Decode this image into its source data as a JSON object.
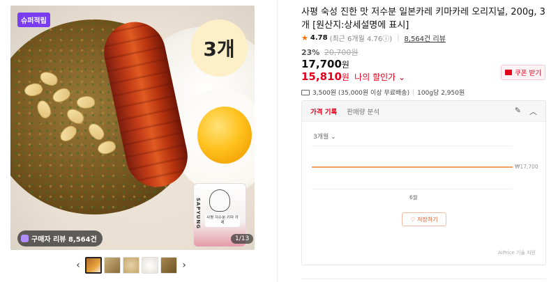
{
  "gallery": {
    "super_badge": "슈퍼적립",
    "count_text": "3개",
    "pouch_brand": "SAPYUNG",
    "pouch_label": "사평 저수분 키마 카레",
    "review_pill": "구매자 리뷰 8,564건",
    "page_indicator": "1/13",
    "prev_arrow": "‹",
    "next_arrow": "›",
    "thumbnail_colors": [
      "#b06a2a",
      "#c9b27c",
      "#e5d1a9",
      "#efe7dc",
      "#a8874d"
    ]
  },
  "product": {
    "title": "사평 숙성 진한 맛 저수분 일본카레 키마카레 오리지널, 200g, 3개 [원산지:상세설명에 표시]",
    "rating": {
      "star": "★",
      "score": "4.78",
      "recent": "(최근 6개월 4.76ⓘ)",
      "separator": "|",
      "reviews": "8,564건 리뷰"
    },
    "discount_percent": "23%",
    "original_price": "20,700원",
    "price_value": "17,700",
    "price_unit": "원",
    "my_price_value": "15,810",
    "my_price_unit": "원",
    "my_price_label": "나의 할인가 ⌄",
    "coupon_button": "쿠폰 받기",
    "shipping": "3,500원 (35,000원 이상 무료배송)",
    "shipping_sep": "|",
    "unit_price": "100g당 2,950원"
  },
  "price_panel": {
    "tabs": [
      "가격 기록",
      "판매량 분석"
    ],
    "edit_icon": "✎",
    "collapse_icon": "︿",
    "period_select": "3개월 ⌄",
    "price_label": "₩17,700",
    "month_label": "6월",
    "save_button": "♡ 저장하기",
    "footnote": "AiPrice 기술 지원"
  },
  "colors": {
    "accent_red": "#e3001b",
    "super_purple": "#7a3cf0",
    "chart_line": "#f0a060"
  }
}
